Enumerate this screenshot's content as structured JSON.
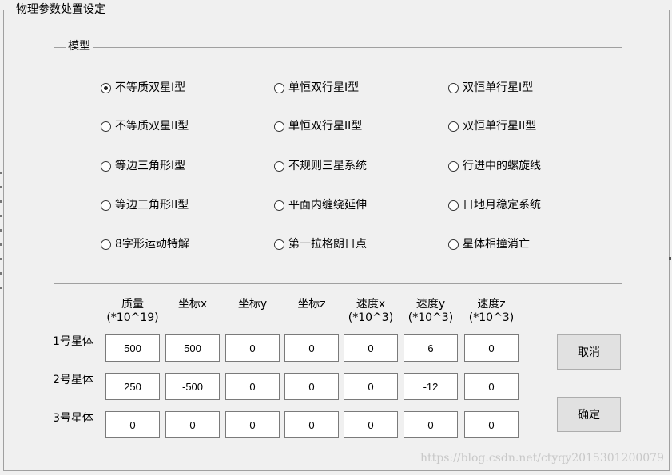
{
  "window": {
    "title": "物理参数处置设定"
  },
  "model_group": {
    "title": "模型",
    "options": [
      {
        "label": "不等质双星I型",
        "checked": true
      },
      {
        "label": "单恒双行星I型",
        "checked": false
      },
      {
        "label": "双恒单行星I型",
        "checked": false
      },
      {
        "label": "不等质双星II型",
        "checked": false
      },
      {
        "label": "单恒双行星II型",
        "checked": false
      },
      {
        "label": "双恒单行星II型",
        "checked": false
      },
      {
        "label": "等边三角形I型",
        "checked": false
      },
      {
        "label": "不规则三星系统",
        "checked": false
      },
      {
        "label": "行进中的螺旋线",
        "checked": false
      },
      {
        "label": "等边三角形II型",
        "checked": false
      },
      {
        "label": "平面内缠绕延伸",
        "checked": false
      },
      {
        "label": "日地月稳定系统",
        "checked": false
      },
      {
        "label": "8字形运动特解",
        "checked": false
      },
      {
        "label": "第一拉格朗日点",
        "checked": false
      },
      {
        "label": "星体相撞消亡",
        "checked": false
      }
    ]
  },
  "params": {
    "columns": [
      {
        "line1": "质量",
        "line2": "(*10^19)"
      },
      {
        "line1": "坐标x",
        "line2": ""
      },
      {
        "line1": "坐标y",
        "line2": ""
      },
      {
        "line1": "坐标z",
        "line2": ""
      },
      {
        "line1": "速度x",
        "line2": "(*10^3)"
      },
      {
        "line1": "速度y",
        "line2": "(*10^3)"
      },
      {
        "line1": "速度z",
        "line2": "(*10^3)"
      }
    ],
    "rows": [
      {
        "label": "1号星体",
        "values": [
          "500",
          "500",
          "0",
          "0",
          "0",
          "6",
          "0"
        ]
      },
      {
        "label": "2号星体",
        "values": [
          "250",
          "-500",
          "0",
          "0",
          "0",
          "-12",
          "0"
        ]
      },
      {
        "label": "3号星体",
        "values": [
          "0",
          "0",
          "0",
          "0",
          "0",
          "0",
          "0"
        ]
      }
    ]
  },
  "buttons": {
    "cancel": "取消",
    "confirm": "确定"
  },
  "watermark": "https://blog.csdn.net/ctyqy2015301200079"
}
